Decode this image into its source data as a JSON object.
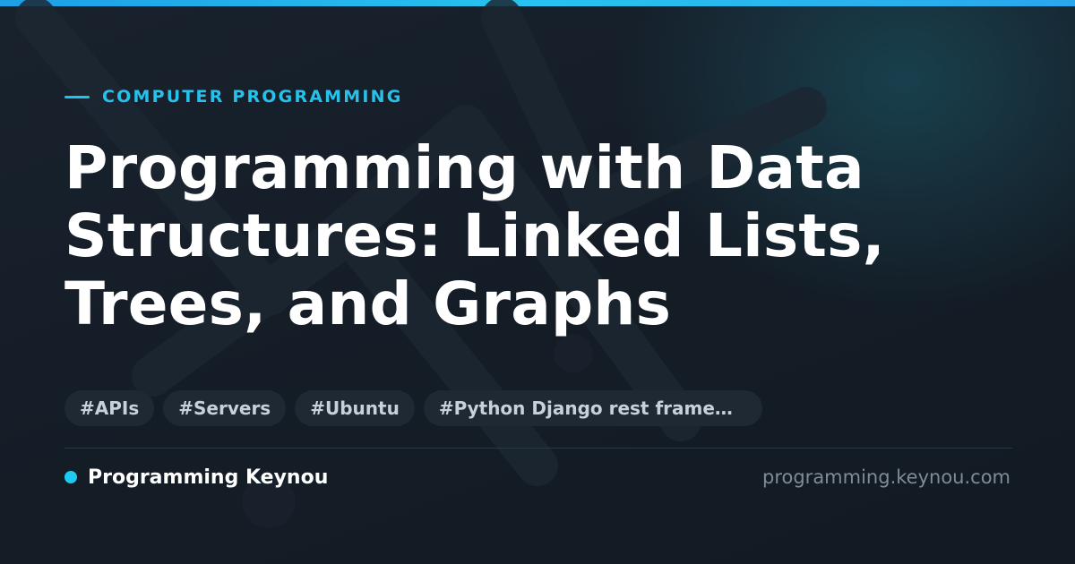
{
  "theme": {
    "background": "#141d27",
    "accent": "#27c2ec",
    "top_bar_start": "#1e9fe6",
    "top_bar_end": "#2aa6ee",
    "title_color": "#ffffff",
    "tag_background": "#1e2933",
    "tag_text": "#c8d1da",
    "url_color": "#7f8c97"
  },
  "category": {
    "label": "COMPUTER PROGRAMMING",
    "icon": "dash-icon"
  },
  "article": {
    "title": "Programming with Data Structures: Linked Lists, Trees, and Graphs"
  },
  "tags": [
    "#APIs",
    "#Servers",
    "#Ubuntu",
    "#Python Django rest framework"
  ],
  "footer": {
    "brand_icon": "dot-icon",
    "brand_name": "Programming Keynou",
    "site_url": "programming.keynou.com"
  }
}
